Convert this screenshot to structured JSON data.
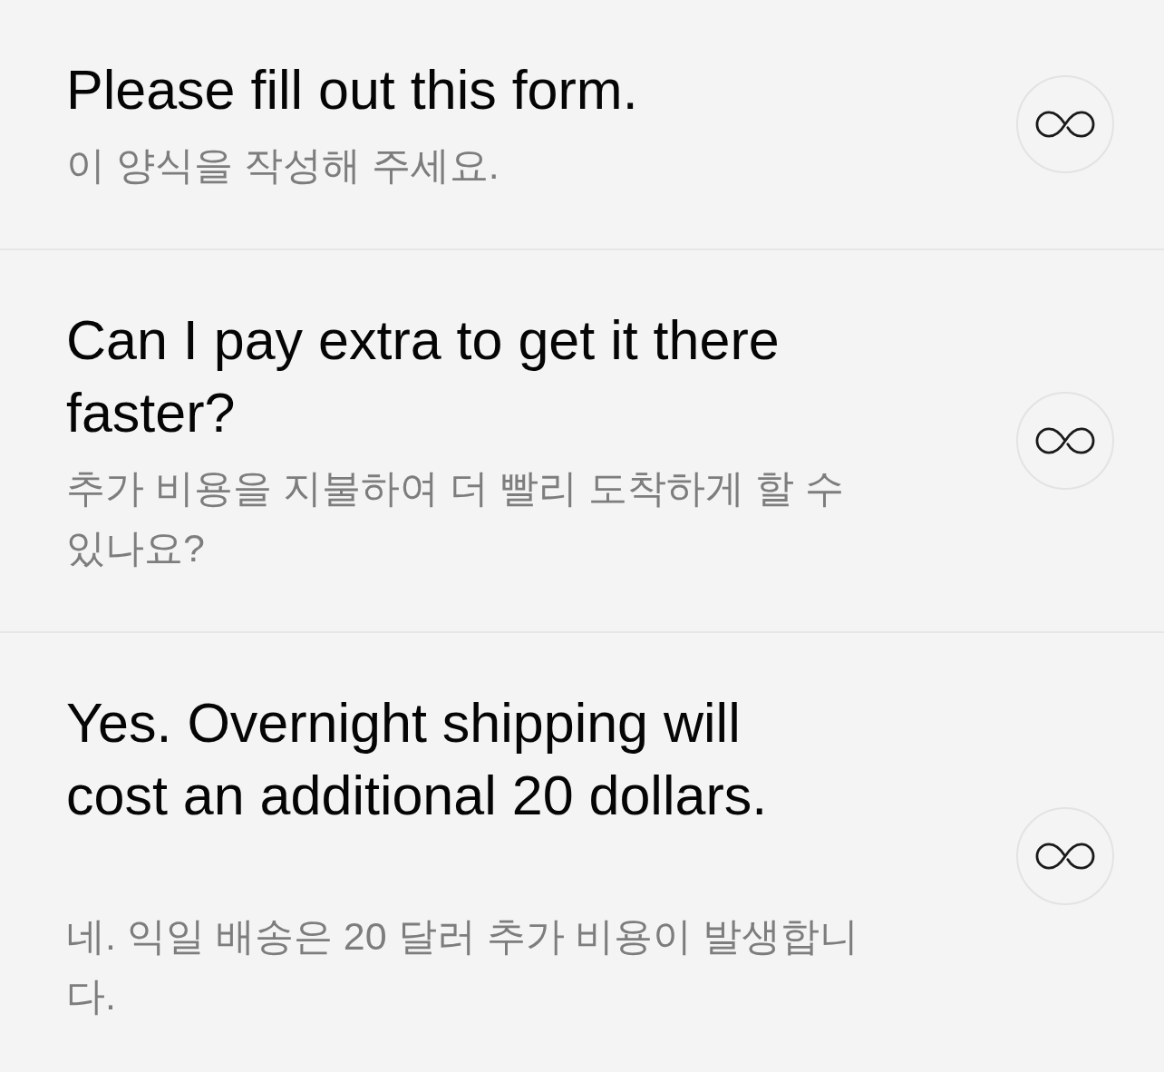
{
  "items": [
    {
      "text": "Please fill out this form.",
      "translation": "이 양식을 작성해 주세요."
    },
    {
      "text": "Can I pay extra to get it there faster?",
      "translation": "추가 비용을 지불하여 더 빨리 도착하게 할 수 있나요?"
    },
    {
      "text": "Yes. Overnight shipping will cost an additional 20 dollars.",
      "translation": "네. 익일 배송은 20 달러 추가 비용이 발생합니다."
    }
  ]
}
